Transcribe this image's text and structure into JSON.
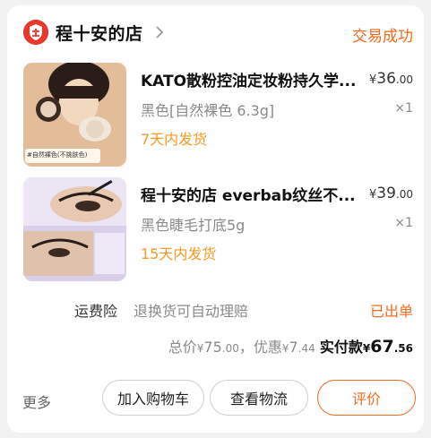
{
  "shop": {
    "name": "程十安的店",
    "status": "交易成功",
    "logo_icon": "shop-shield-icon"
  },
  "items": [
    {
      "title": "KATO散粉控油定妆粉持久学...",
      "price_currency": "¥",
      "price_int": "36",
      "price_dec": ".00",
      "spec": "黑色[自然裸色 6.3g]",
      "qty": "×1",
      "ship": "7天内发货",
      "thumb_badge": "#自然裸色(不挑肤色)"
    },
    {
      "title": "程十安的店  everbab纹丝不...",
      "price_currency": "¥",
      "price_int": "39",
      "price_dec": ".00",
      "spec": "黑色睫毛打底5g",
      "qty": "×1",
      "ship": "15天内发货"
    }
  ],
  "insurance": {
    "label": "运费险",
    "desc": "退换货可自动理赔",
    "status": "已出单"
  },
  "totals": {
    "total_label": "总价",
    "currency": "¥",
    "total_int": "75",
    "total_dec": ".00",
    "discount_label": "，优惠",
    "discount_int": "7",
    "discount_dec": ".44",
    "paid_label": "实付款",
    "paid_int": "67",
    "paid_dec": ".56"
  },
  "actions": {
    "more": "更多",
    "add_cart": "加入购物车",
    "logistics": "查看物流",
    "review": "评价"
  },
  "colors": {
    "accent": "#f26a1b",
    "ship": "#f59a23",
    "logo": "#e8372b"
  }
}
